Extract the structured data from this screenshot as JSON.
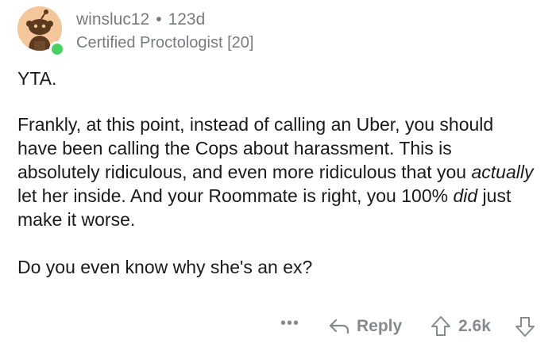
{
  "comment": {
    "author": "winsluc12",
    "separator": "•",
    "age": "123d",
    "flair": "Certified Proctologist [20]",
    "online": true,
    "body": {
      "p1": "YTA.",
      "p2_part1": "Frankly, at this point, instead of calling an Uber, you should have been calling the Cops about harassment. This is absolutely ridiculous, and even more ridiculous that you ",
      "p2_em1": "actually",
      "p2_part2": " let her inside. And your Roommate is right, you 100% ",
      "p2_em2": "did",
      "p2_part3": " just make it worse.",
      "p3": "Do you even know why she's an ex?"
    }
  },
  "footer": {
    "more_label": "•••",
    "reply_label": "Reply",
    "score": "2.6k"
  },
  "icons": {
    "avatar": "snoo-avatar-icon",
    "online": "online-status-dot",
    "reply": "reply-arrow-icon",
    "upvote": "upvote-arrow-icon",
    "downvote": "downvote-arrow-icon",
    "more": "more-options-icon"
  },
  "colors": {
    "meta": "#787c7e",
    "action": "#878a8c",
    "online": "#46d160",
    "avatar_bg": "#f3c79a",
    "text": "#1a1a1b"
  }
}
